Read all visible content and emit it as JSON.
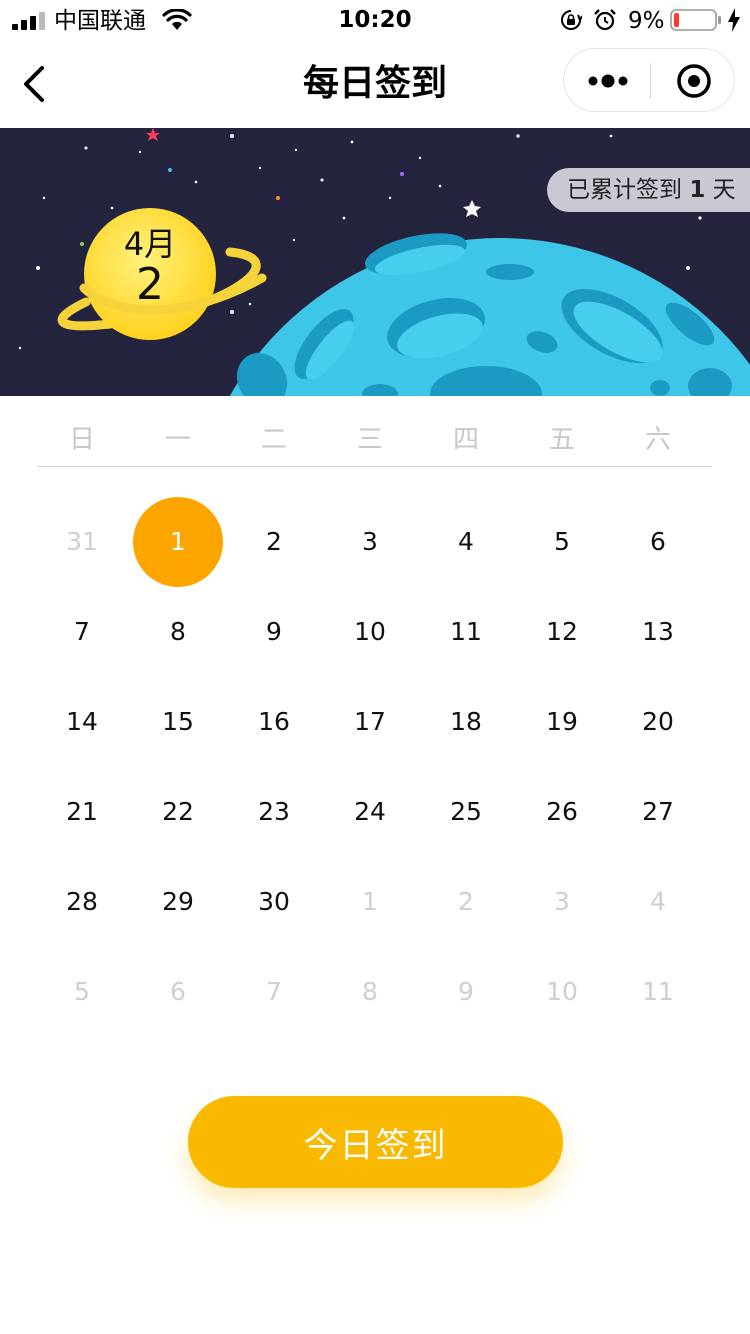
{
  "status_bar": {
    "carrier": "中国联通",
    "time": "10:20",
    "battery_percent": "9%",
    "icons": [
      "signal-icon",
      "wifi-icon",
      "orientation-lock-icon",
      "alarm-icon",
      "battery-icon",
      "charging-icon"
    ]
  },
  "nav": {
    "title": "每日签到",
    "icons": [
      "back-icon",
      "more-icon",
      "close-miniprogram-icon"
    ]
  },
  "banner": {
    "month": "4月",
    "day": "2",
    "streak_prefix": "已累计签到",
    "streak_count": "1",
    "streak_suffix": "天"
  },
  "calendar": {
    "weekdays": [
      "日",
      "一",
      "二",
      "三",
      "四",
      "五",
      "六"
    ],
    "weeks": [
      [
        {
          "d": "31",
          "other": true
        },
        {
          "d": "1",
          "checked": true
        },
        {
          "d": "2"
        },
        {
          "d": "3"
        },
        {
          "d": "4"
        },
        {
          "d": "5"
        },
        {
          "d": "6"
        }
      ],
      [
        {
          "d": "7"
        },
        {
          "d": "8"
        },
        {
          "d": "9"
        },
        {
          "d": "10"
        },
        {
          "d": "11"
        },
        {
          "d": "12"
        },
        {
          "d": "13"
        }
      ],
      [
        {
          "d": "14"
        },
        {
          "d": "15"
        },
        {
          "d": "16"
        },
        {
          "d": "17"
        },
        {
          "d": "18"
        },
        {
          "d": "19"
        },
        {
          "d": "20"
        }
      ],
      [
        {
          "d": "21"
        },
        {
          "d": "22"
        },
        {
          "d": "23"
        },
        {
          "d": "24"
        },
        {
          "d": "25"
        },
        {
          "d": "26"
        },
        {
          "d": "27"
        }
      ],
      [
        {
          "d": "28"
        },
        {
          "d": "29"
        },
        {
          "d": "30"
        },
        {
          "d": "1",
          "other": true
        },
        {
          "d": "2",
          "other": true
        },
        {
          "d": "3",
          "other": true
        },
        {
          "d": "4",
          "other": true
        }
      ],
      [
        {
          "d": "5",
          "other": true
        },
        {
          "d": "6",
          "other": true
        },
        {
          "d": "7",
          "other": true
        },
        {
          "d": "8",
          "other": true
        },
        {
          "d": "9",
          "other": true
        },
        {
          "d": "10",
          "other": true
        },
        {
          "d": "11",
          "other": true
        }
      ]
    ],
    "checked_color": "#ffa500"
  },
  "checkin_button": {
    "label": "今日签到",
    "color": "#f9b900"
  }
}
